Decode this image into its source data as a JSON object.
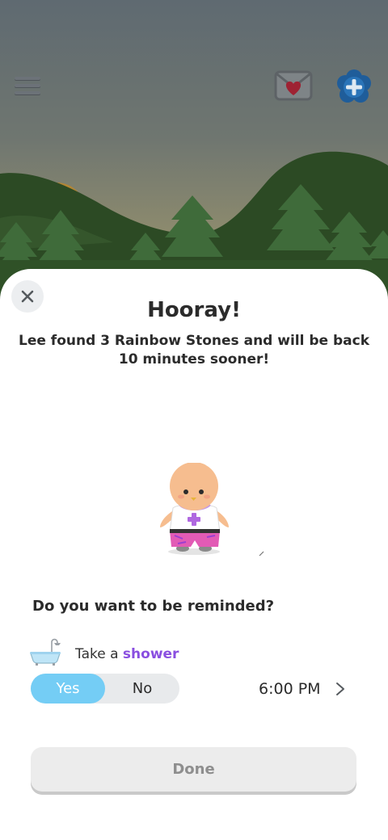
{
  "header": {
    "menu_icon": "hamburger-menu-icon",
    "mail_icon": "envelope-heart-icon",
    "add_icon": "flower-plus-icon"
  },
  "dialog": {
    "close_icon": "close-icon",
    "title": "Hooray!",
    "message": "Lee found 3 Rainbow Stones and will be back 10 minutes sooner!",
    "reminder_question": "Do you want to be reminded?",
    "task": {
      "icon": "bathtub-icon",
      "prefix": "Take a",
      "name": "shower"
    },
    "toggle": {
      "yes_label": "Yes",
      "no_label": "No",
      "selected": "Yes"
    },
    "time": "6:00 PM",
    "done_label": "Done"
  },
  "colors": {
    "accent_purple": "#8a4fe0",
    "toggle_selected": "#74cdf5",
    "sky_top": "#5f6a71",
    "mountain": "#2c4a24",
    "tree": "#3f6b3a"
  }
}
